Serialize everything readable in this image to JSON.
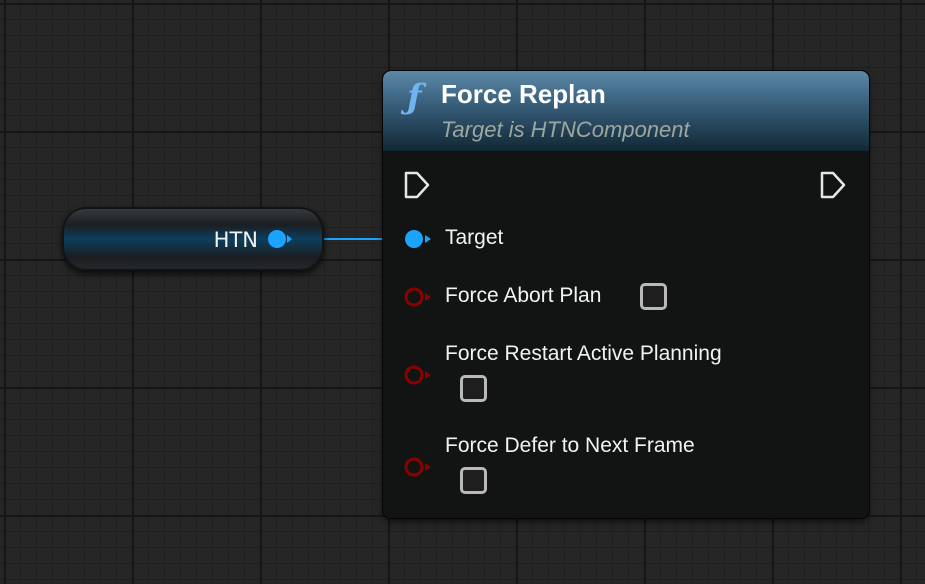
{
  "variable_node": {
    "label": "HTN",
    "pin_color": "#1aa3ff",
    "icon": "object-reference-pin-icon"
  },
  "function_node": {
    "icon_glyph": "ƒ",
    "icon_name": "function-icon",
    "title": "Force Replan",
    "subtitle": "Target is HTNComponent",
    "header_color": "#3d6582",
    "exec_in_icon": "exec-input-pin-icon",
    "exec_out_icon": "exec-output-pin-icon",
    "pins": {
      "target": {
        "label": "Target",
        "color": "#1aa3ff"
      },
      "force_abort_plan": {
        "label": "Force Abort Plan",
        "color": "#8b0000",
        "checked": false
      },
      "force_restart_active_planning": {
        "label": "Force Restart Active Planning",
        "color": "#8b0000",
        "checked": false
      },
      "force_defer_to_next_frame": {
        "label": "Force Defer to Next Frame",
        "color": "#8b0000",
        "checked": false
      }
    }
  },
  "wire_color": "#1aa3ff"
}
